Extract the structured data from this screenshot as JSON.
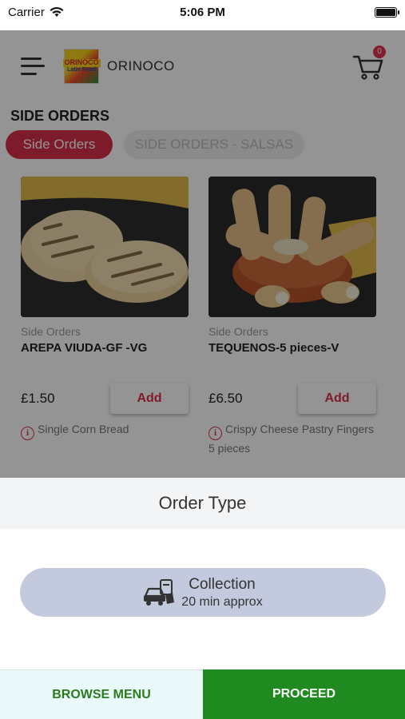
{
  "status_bar": {
    "carrier": "Carrier",
    "time": "5:06 PM",
    "wifi_icon": "wifi-icon",
    "battery_icon": "battery-icon"
  },
  "header": {
    "brand": "ORINOCO",
    "logo_line1": "ORINOCO",
    "logo_line2": "Latin Food",
    "cart_count": "0",
    "menu_icon": "hamburger-menu-icon",
    "cart_icon": "shopping-cart-icon"
  },
  "section": {
    "title": "SIDE ORDERS",
    "tabs": [
      {
        "label": "Side Orders",
        "active": true
      },
      {
        "label": "SIDE ORDERS - SALSAS",
        "active": false
      }
    ]
  },
  "products": [
    {
      "category": "Side Orders",
      "name": "AREPA VIUDA-GF -VG",
      "price": "£1.50",
      "add_label": "Add",
      "description": "Single Corn Bread"
    },
    {
      "category": "Side Orders",
      "name": "TEQUENOS-5 pieces-V",
      "price": "£6.50",
      "add_label": "Add",
      "description": "Crispy Cheese Pastry Fingers 5 pieces"
    }
  ],
  "order_sheet": {
    "title": "Order Type",
    "option": {
      "title": "Collection",
      "subtitle": "20 min approx",
      "icon": "collection-car-icon"
    }
  },
  "footer": {
    "browse_label": "BROWSE MENU",
    "proceed_label": "PROCEED"
  },
  "colors": {
    "accent": "#d9304a",
    "proceed": "#1f8a1f",
    "browse_text": "#2b7a1e",
    "collection_bg": "#c4cade"
  }
}
